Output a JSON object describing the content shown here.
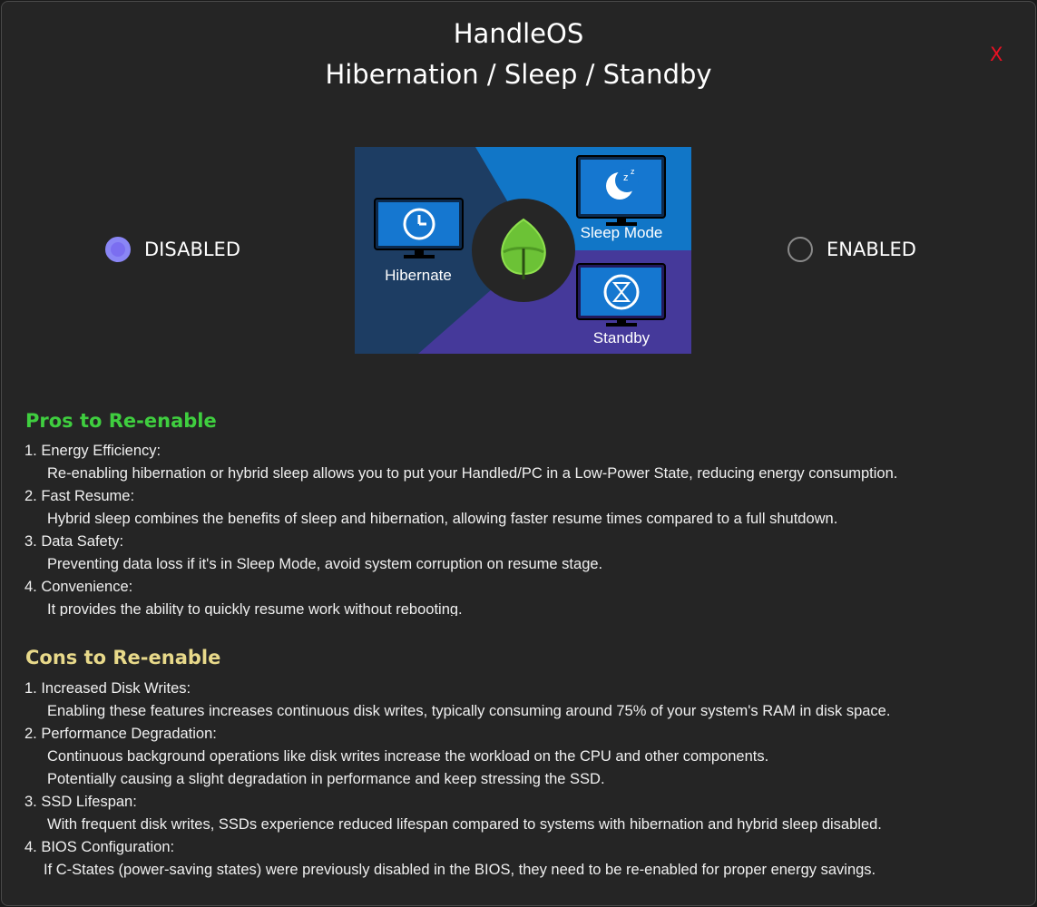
{
  "header": {
    "title_line1": "HandleOS",
    "title_line2": "Hibernation / Sleep / Standby",
    "close_label": "X"
  },
  "options": {
    "disabled_label": "DISABLED",
    "enabled_label": "ENABLED",
    "selected": "DISABLED"
  },
  "illustration": {
    "hibernate_label": "Hibernate",
    "sleep_label": "Sleep Mode",
    "standby_label": "Standby",
    "sleep_glyph": "z",
    "icons": [
      "clock-icon",
      "moon-icon",
      "hourglass-icon",
      "leaf-icon"
    ]
  },
  "pros": {
    "title": "Pros to Re-enable",
    "items": [
      {
        "heading": "1. Energy Efficiency:",
        "lines": [
          "Re-enabling hibernation or hybrid sleep allows you to put your Handled/PC in a Low-Power State, reducing energy consumption."
        ]
      },
      {
        "heading": "2. Fast Resume:",
        "lines": [
          "Hybrid sleep combines the benefits of sleep and hibernation, allowing faster resume times compared to a full shutdown."
        ]
      },
      {
        "heading": "3. Data Safety:",
        "lines": [
          "Preventing data loss if it's in Sleep Mode, avoid system corruption on resume stage."
        ]
      },
      {
        "heading": "4. Convenience:",
        "lines": [
          "It provides the ability to quickly resume work without rebooting."
        ]
      }
    ]
  },
  "cons": {
    "title": "Cons to Re-enable",
    "items": [
      {
        "heading": "1. Increased Disk Writes:",
        "lines": [
          "Enabling these features increases continuous disk writes, typically consuming around 75% of your system's RAM in disk space."
        ]
      },
      {
        "heading": "2. Performance Degradation:",
        "lines": [
          "Continuous background operations like disk writes increase the workload on the CPU and other components.",
          "Potentially causing a slight degradation in performance and keep stressing the SSD."
        ]
      },
      {
        "heading": "3. SSD Lifespan:",
        "lines": [
          "With frequent disk writes, SSDs experience reduced lifespan compared to systems with hibernation and hybrid sleep disabled."
        ]
      },
      {
        "heading": "4. BIOS Configuration:",
        "lines": [
          "If C-States (power-saving states) were previously disabled in the BIOS, they need to be re-enabled for proper energy savings."
        ]
      }
    ]
  },
  "colors": {
    "background": "#252525",
    "close": "#e81123",
    "pros_title": "#3fce3f",
    "cons_title": "#e8d98a",
    "radio_checked": "#7b6ef0",
    "hibernate_panel": "#1d3d63",
    "sleep_panel": "#1176c7",
    "standby_panel": "#45399a",
    "leaf": "#6cc236"
  }
}
